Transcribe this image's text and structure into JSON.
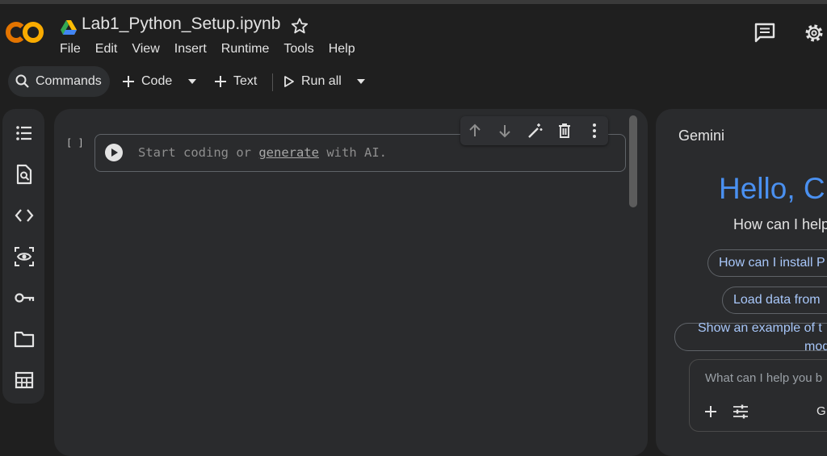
{
  "app": {
    "logo_text": "CO",
    "doc_title": "Lab1_Python_Setup.ipynb"
  },
  "menu": [
    "File",
    "Edit",
    "View",
    "Insert",
    "Runtime",
    "Tools",
    "Help"
  ],
  "toolbar": {
    "commands_label": "Commands",
    "code_label": "Code",
    "text_label": "Text",
    "run_all_label": "Run all"
  },
  "cell": {
    "brackets": "[ ]",
    "prefix": "Start coding or",
    "link": "generate",
    "suffix": "with AI."
  },
  "gemini": {
    "title": "Gemini",
    "greeting": "Hello, C",
    "subtitle": "How can I help",
    "chips": [
      "How can I install P",
      "Load data from",
      "Show an example of t"
    ],
    "chip3_line2": "mod",
    "input_placeholder": "What can I help you b",
    "model_label": "G"
  },
  "colors": {
    "accent_blue": "#4a90f0",
    "chip_text": "#a8c7fa",
    "logo_orange": "#f9ab00",
    "logo_orange_dark": "#e37400"
  }
}
